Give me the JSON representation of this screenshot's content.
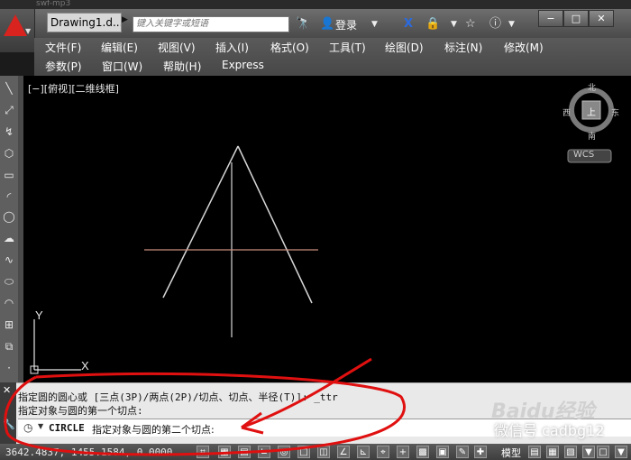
{
  "window": {
    "caption": "swf-mp3"
  },
  "titlebar": {
    "doc_title": "Drawing1.d...",
    "search_placeholder": "键入关键字或短语",
    "login": "登录"
  },
  "menus": {
    "row1": [
      "文件(F)",
      "编辑(E)",
      "视图(V)",
      "插入(I)",
      "格式(O)",
      "工具(T)",
      "绘图(D)",
      "标注(N)",
      "修改(M)"
    ],
    "row2": [
      "参数(P)",
      "窗口(W)",
      "帮助(H)",
      "Express"
    ]
  },
  "viewport": {
    "label": "[−][俯视][二维线框]",
    "compass": {
      "north": "北",
      "south": "南",
      "east": "东",
      "west": "西",
      "top": "上"
    },
    "wcs": "WCS"
  },
  "command": {
    "line1": "指定圆的圆心或 [三点(3P)/两点(2P)/切点、切点、半径(T)]: _ttr",
    "line2": "指定对象与圆的第一个切点:",
    "current_cmd": "CIRCLE",
    "current_prompt": "指定对象与圆的第二个切点:"
  },
  "statusbar": {
    "coords": "3642.4837, 1455.1584, 0.0000",
    "model": "模型"
  },
  "overlay": {
    "baidu": "Baidu经验",
    "watermark": "微信号 cadbg12"
  },
  "colors": {
    "accent_red": "#d8231e",
    "line_color": "#d6d6d6",
    "axis_color": "#c98c7c"
  }
}
